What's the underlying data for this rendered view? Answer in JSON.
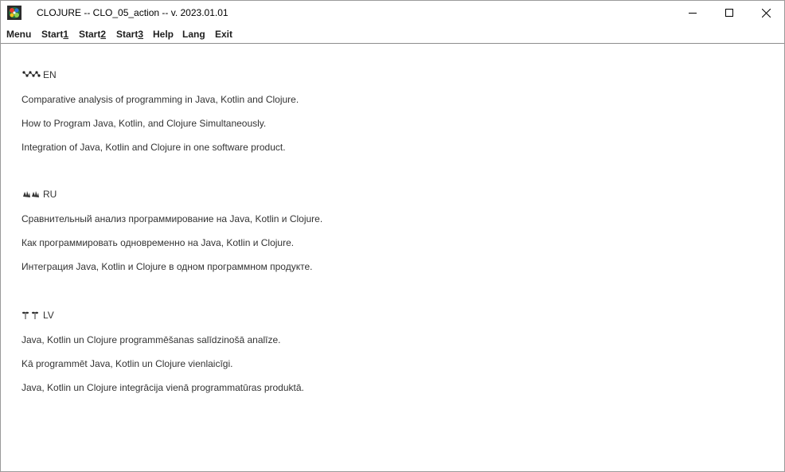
{
  "window": {
    "title": "CLOJURE -- CLO_05_action -- v. 2023.01.01",
    "icon": "clojure-app-icon",
    "controls": [
      "minimize-icon",
      "maximize-icon",
      "close-icon"
    ]
  },
  "menubar": {
    "items": [
      {
        "main": "Menu",
        "mn": ""
      },
      {
        "main": "Start",
        "mn": "1"
      },
      {
        "main": "Start",
        "mn": "2"
      },
      {
        "main": "Start",
        "mn": "3"
      },
      {
        "main": "Help",
        "mn": ""
      },
      {
        "main": "Lang",
        "mn": ""
      },
      {
        "main": "Exit",
        "mn": ""
      }
    ]
  },
  "content": {
    "sections": [
      {
        "lang": "EN",
        "icon": "molecule-icon",
        "lines": [
          "Comparative analysis of programming in Java, Kotlin and Clojure.",
          "How to Program Java, Kotlin, and Clojure Simultaneously.",
          "Integration of Java, Kotlin and Clojure in one software product."
        ]
      },
      {
        "lang": "RU",
        "icon": "waving-hands-icon",
        "lines": [
          "Сравнительный анализ программирование на Java, Kotlin и Clojure.",
          "Как программировать одновременно на Java, Kotlin и Clojure.",
          "Интеграция Java, Kotlin и Clojure в одном программном продукте."
        ]
      },
      {
        "lang": "LV",
        "icon": "sprout-icon",
        "lines": [
          "Java, Kotlin un Clojure programmēšanas salīdzinošā analīze.",
          "Kā programmēt Java, Kotlin un Clojure vienlaicīgi.",
          "Java, Kotlin un Clojure integrācija vienā programmatūras produktā."
        ]
      }
    ]
  },
  "colors": {
    "text": "#333333",
    "menu_text": "#1e1e1e",
    "separator": "#8d8d8d",
    "background": "#ffffff"
  }
}
